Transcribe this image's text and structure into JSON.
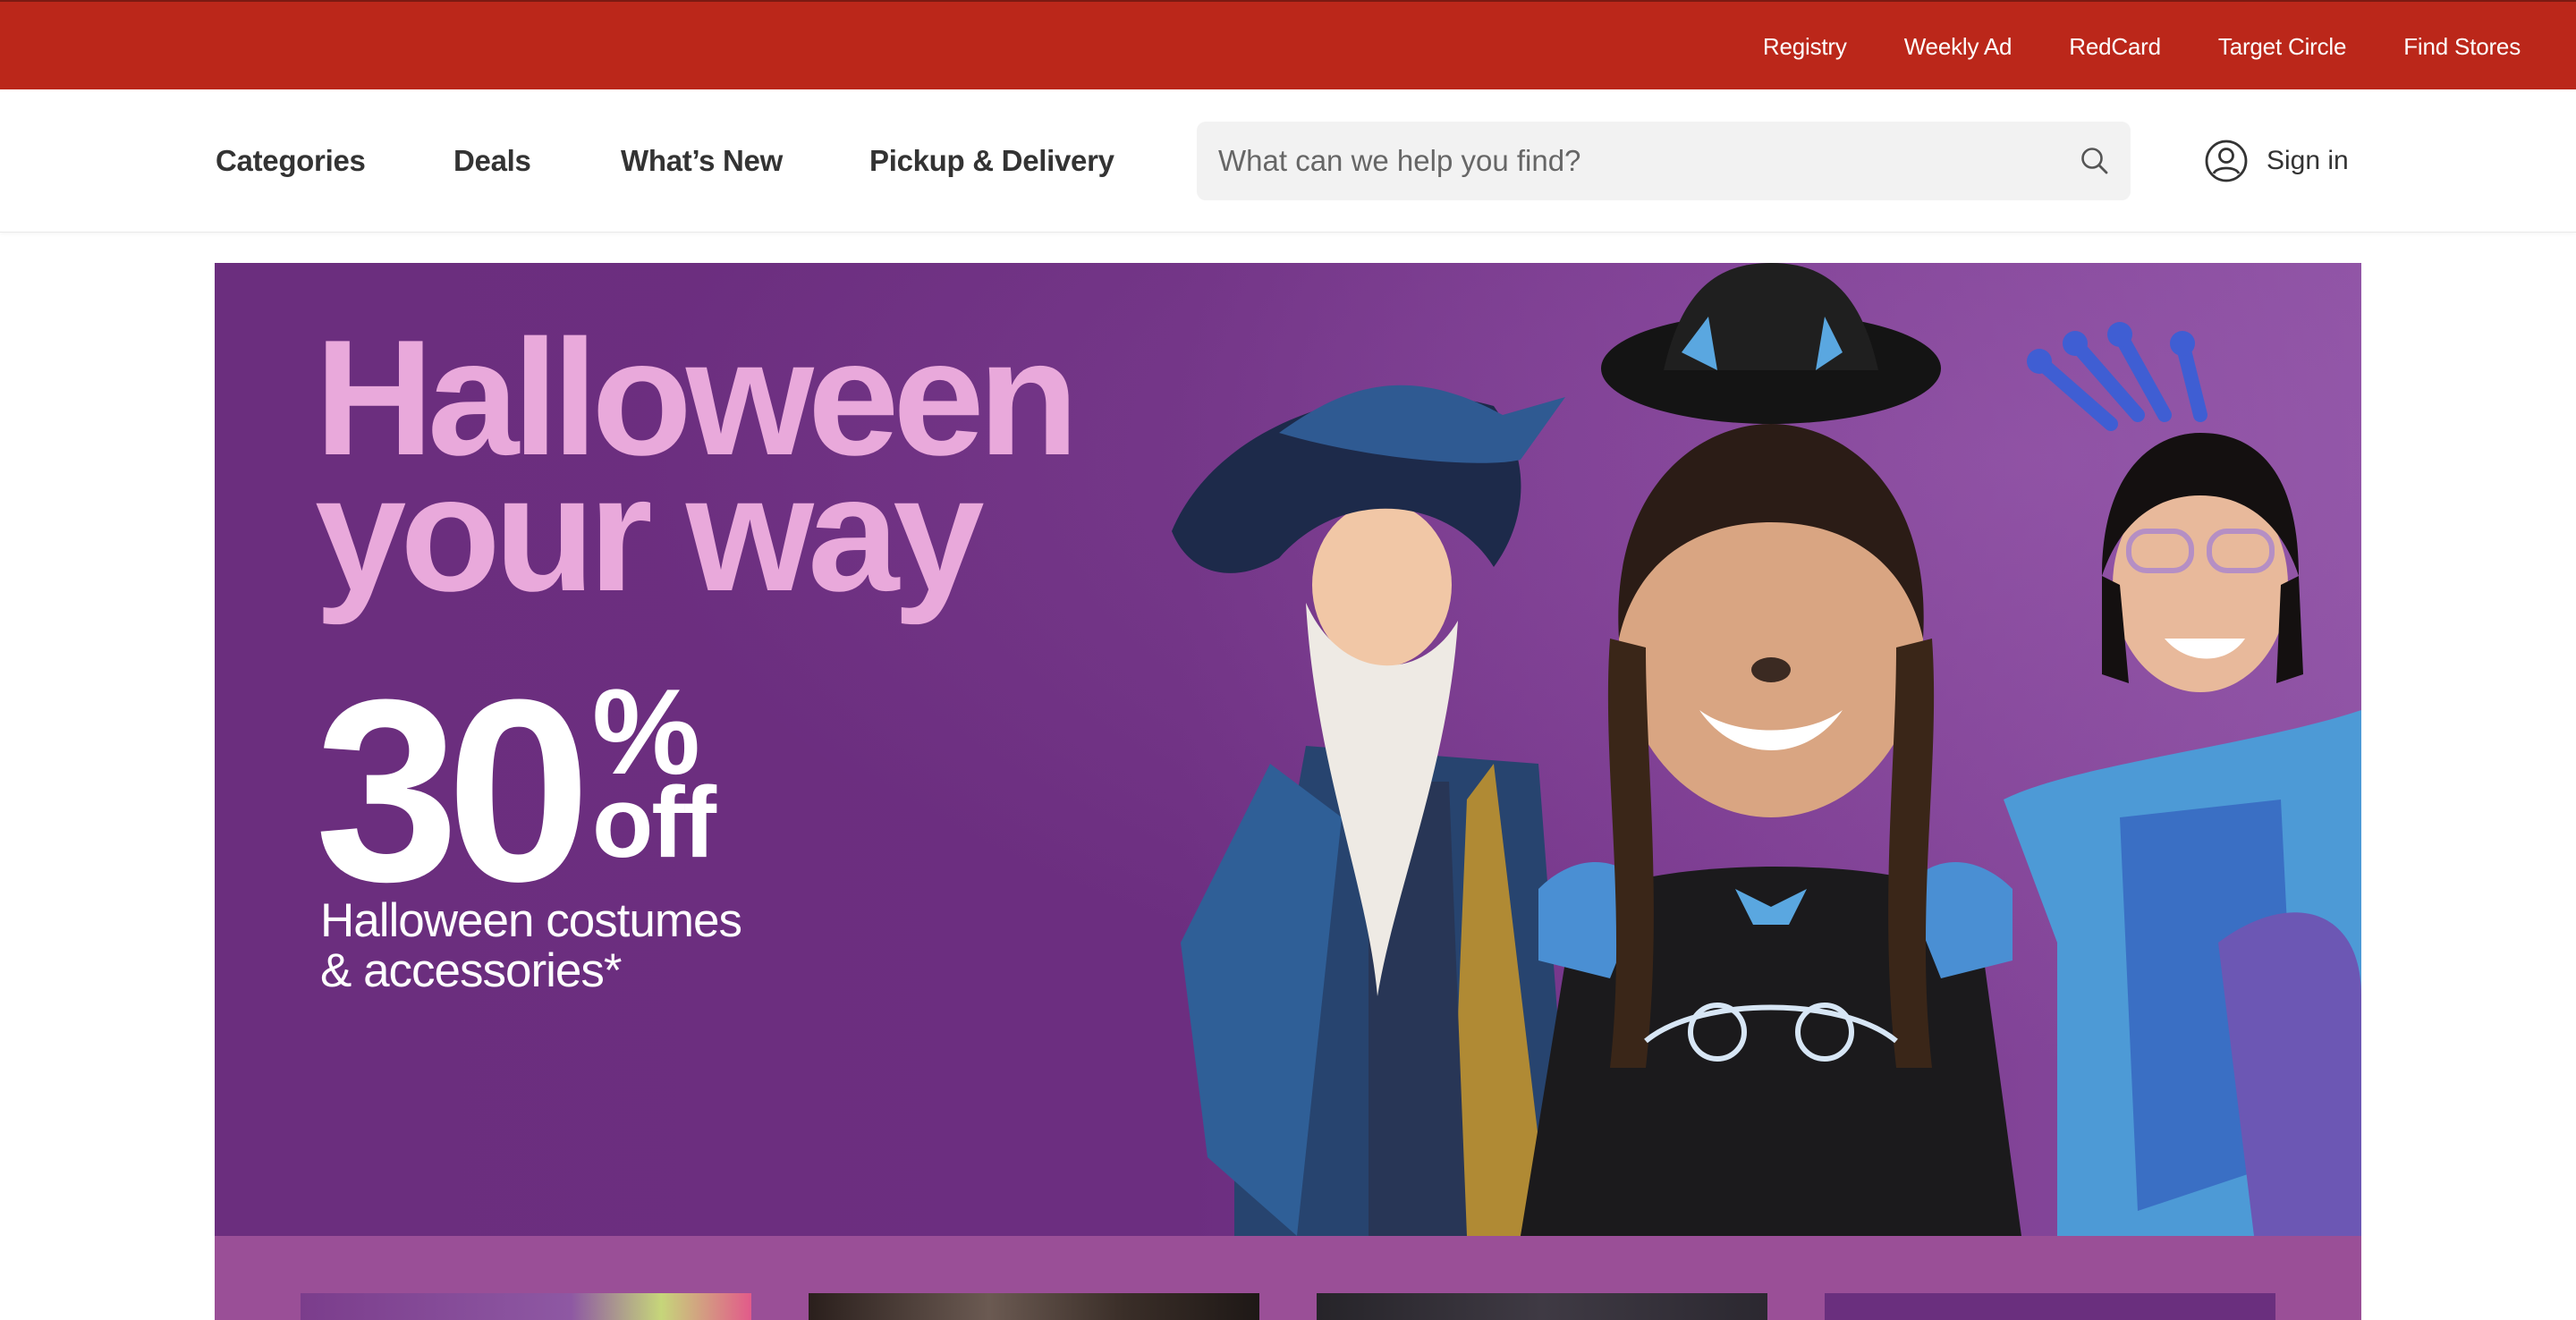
{
  "utility_nav": {
    "links": [
      "Registry",
      "Weekly Ad",
      "RedCard",
      "Target Circle",
      "Find Stores"
    ]
  },
  "header": {
    "nav": {
      "categories": "Categories",
      "deals": "Deals",
      "whats_new": "What’s New",
      "pickup_delivery": "Pickup & Delivery"
    },
    "search": {
      "placeholder": "What can we help you find?",
      "icon": "search-icon"
    },
    "account": {
      "label": "Sign in",
      "icon": "account-icon"
    }
  },
  "hero": {
    "headline_line1": "Halloween",
    "headline_line2": "your way",
    "discount_number": "30",
    "discount_percent": "%",
    "discount_off": "off",
    "subtitle_line1": "Halloween costumes",
    "subtitle_line2": "& accessories*"
  },
  "colors": {
    "utility_bar": "#bb271a",
    "hero_background": "#6c2e80",
    "hero_headline": "#e9a9db",
    "promo_strip": "#9a4f97"
  }
}
